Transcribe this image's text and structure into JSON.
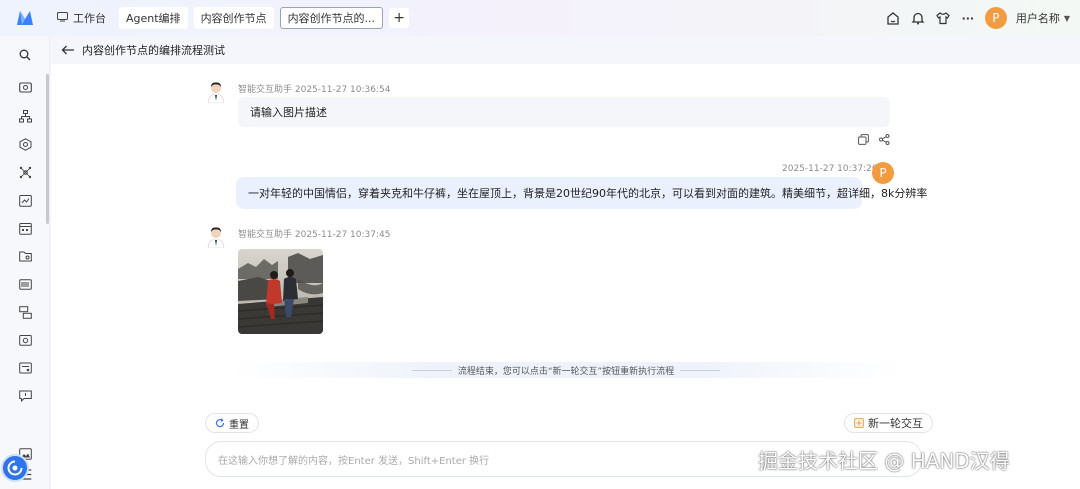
{
  "topbar": {
    "tabs": [
      {
        "label": "工作台",
        "icon": "monitor-icon"
      },
      {
        "label": "Agent编排"
      },
      {
        "label": "内容创作节点"
      },
      {
        "label": "内容创作节点的..."
      }
    ],
    "user": {
      "avatar_letter": "P",
      "name": "用户名称"
    },
    "more": "···"
  },
  "header": {
    "title": "内容创作节点的编排流程测试"
  },
  "chat": {
    "messages": [
      {
        "role": "bot",
        "meta": "智能交互助手 2025-11-27 10:36:54",
        "text": "请输入图片描述"
      },
      {
        "role": "user",
        "meta": "2025-11-27 10:37:26",
        "avatar_letter": "P",
        "text": "一对年轻的中国情侣，穿着夹克和牛仔裤，坐在屋顶上，背景是20世纪90年代的北京，可以看到对面的建筑。精美细节，超详细，8k分辨率"
      },
      {
        "role": "bot",
        "meta": "智能交互助手 2025-11-27 10:37:45",
        "image": "ink-painting-couple-on-rooftop"
      }
    ],
    "end_note": "流程结束，您可以点击“新一轮交互”按钮重新执行流程"
  },
  "controls": {
    "reset_label": "重置",
    "new_round_label": "新一轮交互",
    "input_placeholder": "在这输入你想了解的内容，按Enter 发送，Shift+Enter 换行"
  },
  "watermark": "掘金技术社区 @ HAND汉得",
  "colors": {
    "accent": "#2f74e8",
    "avatar": "#f39b3f",
    "user_bubble": "#eaf0fd",
    "bot_bubble": "#f5f6f9"
  }
}
